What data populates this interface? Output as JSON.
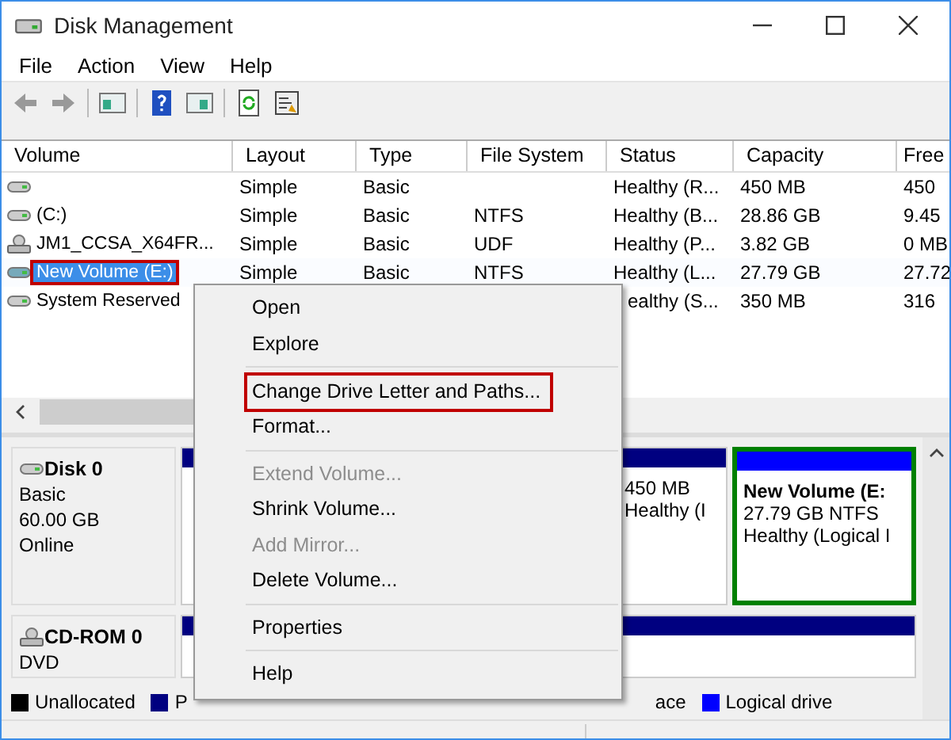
{
  "window": {
    "title": "Disk Management"
  },
  "menu_bar": [
    "File",
    "Action",
    "View",
    "Help"
  ],
  "table": {
    "columns": [
      "Volume",
      "Layout",
      "Type",
      "File System",
      "Status",
      "Capacity",
      "Free"
    ],
    "rows": [
      {
        "kind": "disk",
        "selected": false,
        "annotated": false,
        "layout": "Simple",
        "type": "Basic",
        "status": "Healthy (R...",
        "capacity": "450 MB",
        "free": "450"
      },
      {
        "kind": "disk",
        "selected": false,
        "annotated": false,
        "volume": "(C:)",
        "layout": "Simple",
        "type": "Basic",
        "file_system": "NTFS",
        "status": "Healthy (B...",
        "capacity": "28.86 GB",
        "free": "9.45"
      },
      {
        "kind": "optical",
        "selected": false,
        "annotated": false,
        "volume": "JM1_CCSA_X64FR...",
        "layout": "Simple",
        "type": "Basic",
        "file_system": "UDF",
        "status": "Healthy (P...",
        "capacity": "3.82 GB",
        "free": "0 MB"
      },
      {
        "kind": "disk",
        "selected": true,
        "annotated": true,
        "volume": "New Volume (E:)",
        "layout": "Simple",
        "type": "Basic",
        "file_system": "NTFS",
        "status": "Healthy (L...",
        "capacity": "27.79 GB",
        "free": "27.72"
      },
      {
        "kind": "disk",
        "selected": false,
        "annotated": false,
        "volume": "System Reserved",
        "status": "ealthy (S...",
        "capacity": "350 MB",
        "free": "316"
      }
    ]
  },
  "disks": [
    {
      "kind": "disk",
      "name": "Disk 0",
      "details": [
        "Basic",
        "60.00 GB",
        "Online"
      ],
      "partitions": [
        {
          "kind": "primary",
          "selected": false
        },
        {
          "kind": "primary",
          "selected": false,
          "lines": [
            "450 MB",
            "Healthy (I"
          ]
        },
        {
          "kind": "logical",
          "selected": true,
          "lines": [
            "New Volume  (E:",
            "27.79 GB NTFS",
            "Healthy (Logical I"
          ]
        }
      ]
    },
    {
      "kind": "optical",
      "name": "CD-ROM 0",
      "details": [
        "DVD"
      ],
      "partitions": [
        {
          "kind": "primary",
          "selected": false
        }
      ]
    }
  ],
  "legend": [
    {
      "label": "Unallocated",
      "color": "#000000"
    },
    {
      "label": "P",
      "color": "#000080"
    },
    {
      "label": "ace"
    },
    {
      "label": "Logical drive",
      "color": "#0000ff"
    }
  ],
  "context_menu": [
    [
      {
        "label": "Open",
        "disabled": false,
        "annotated": false
      },
      {
        "label": "Explore",
        "disabled": false,
        "annotated": false
      }
    ],
    [
      {
        "label": "Change Drive Letter and Paths...",
        "disabled": false,
        "annotated": true
      },
      {
        "label": "Format...",
        "disabled": false,
        "annotated": false
      }
    ],
    [
      {
        "label": "Extend Volume...",
        "disabled": true,
        "annotated": false
      },
      {
        "label": "Shrink Volume...",
        "disabled": false,
        "annotated": false
      },
      {
        "label": "Add Mirror...",
        "disabled": true,
        "annotated": false
      },
      {
        "label": "Delete Volume...",
        "disabled": false,
        "annotated": false
      }
    ],
    [
      {
        "label": "Properties",
        "disabled": false,
        "annotated": false
      }
    ],
    [
      {
        "label": "Help",
        "disabled": false,
        "annotated": false
      }
    ]
  ]
}
